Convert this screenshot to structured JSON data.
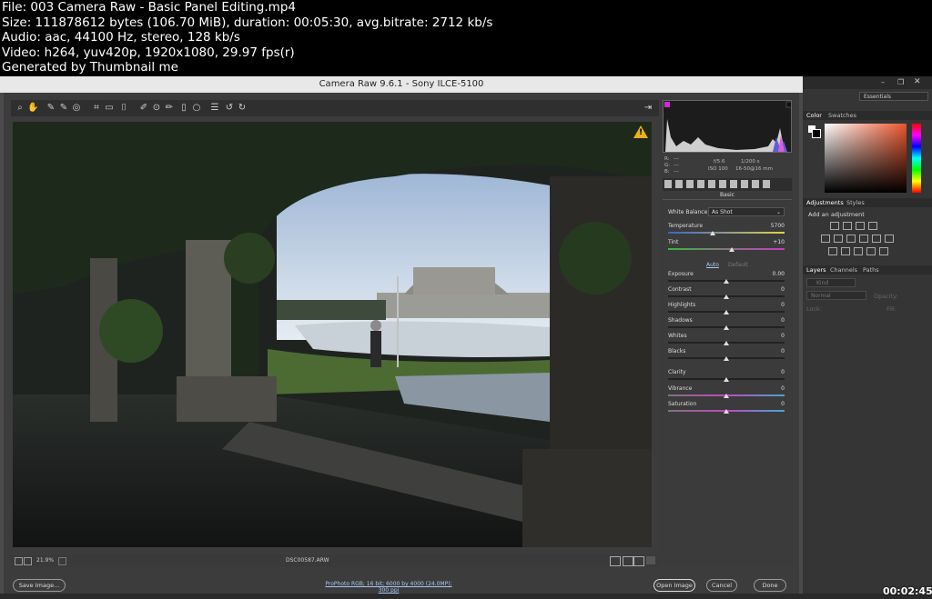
{
  "info": {
    "file": "File: 003 Camera Raw - Basic Panel Editing.mp4",
    "size": "Size: 111878612 bytes (106.70 MiB), duration: 00:05:30, avg.bitrate: 2712 kb/s",
    "audio": "Audio: aac, 44100 Hz, stereo, 128 kb/s",
    "video": "Video: h264, yuv420p, 1920x1080, 29.97 fps(r)",
    "generated": "Generated by Thumbnail me"
  },
  "camera_raw": {
    "title": "Camera Raw 9.6.1  -  Sony ILCE-5100",
    "zoom": "21.9%",
    "filename": "DSC00587.ARW",
    "workflow_link": "ProPhoto RGB; 16 bit; 6000 by 4000 (24.0MP); 300 ppi",
    "save_label": "Save Image...",
    "open_label": "Open Image",
    "cancel_label": "Cancel",
    "done_label": "Done",
    "readout": {
      "r": "R:",
      "g": "G:",
      "b": "B:",
      "dash": "---",
      "aperture": "f/5.6",
      "shutter": "1/200 s",
      "iso": "ISO 100",
      "lens": "16-50@16 mm"
    },
    "basic": {
      "header": "Basic",
      "wb_label": "White Balance:",
      "wb_value": "As Shot",
      "auto": "Auto",
      "default": "Default",
      "sliders": [
        {
          "label": "Temperature",
          "value": "5700"
        },
        {
          "label": "Tint",
          "value": "+10"
        },
        {
          "label": "Exposure",
          "value": "0.00"
        },
        {
          "label": "Contrast",
          "value": "0"
        },
        {
          "label": "Highlights",
          "value": "0"
        },
        {
          "label": "Shadows",
          "value": "0"
        },
        {
          "label": "Whites",
          "value": "0"
        },
        {
          "label": "Blacks",
          "value": "0"
        },
        {
          "label": "Clarity",
          "value": "0"
        },
        {
          "label": "Vibrance",
          "value": "0"
        },
        {
          "label": "Saturation",
          "value": "0"
        }
      ]
    }
  },
  "photoshop": {
    "workspace": "Essentials",
    "color_tab": "Color",
    "swatches_tab": "Swatches",
    "adjustments_tab": "Adjustments",
    "styles_tab": "Styles",
    "add_adjustment": "Add an adjustment",
    "layers_tab": "Layers",
    "channels_tab": "Channels",
    "paths_tab": "Paths",
    "kind": "Kind",
    "blend_mode": "Normal",
    "opacity": "Opacity:",
    "lock": "Lock:",
    "fill": "Fill:"
  },
  "timestamp": "00:02:45"
}
